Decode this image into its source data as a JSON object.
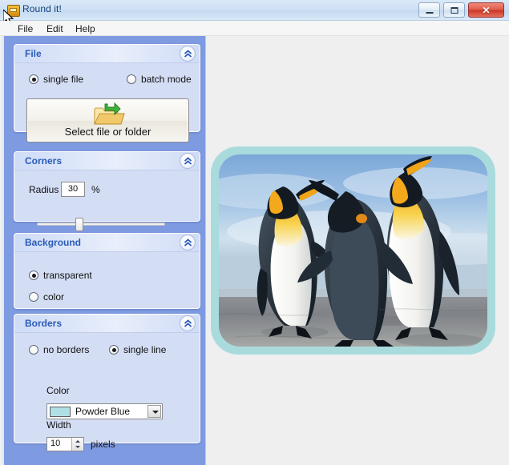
{
  "window": {
    "title": "Round it!",
    "icon": "app-icon",
    "buttons": {
      "minimize": "–",
      "maximize": "□",
      "close": "✕"
    }
  },
  "menubar": {
    "items": [
      {
        "label": "File"
      },
      {
        "label": "Edit"
      },
      {
        "label": "Help"
      }
    ]
  },
  "panels": {
    "file": {
      "title": "File",
      "collapse_icon": "double-chevron-up-icon",
      "radios": [
        {
          "label": "single file",
          "selected": true
        },
        {
          "label": "batch mode",
          "selected": false
        }
      ],
      "select_button": {
        "label": "Select file or folder",
        "icon": "open-folder-with-arrow-icon"
      }
    },
    "corners": {
      "title": "Corners",
      "collapse_icon": "double-chevron-up-icon",
      "radius_label": "Radius",
      "radius_value": "30",
      "unit": "%",
      "slider": {
        "value": 30,
        "min": 0,
        "max": 100
      }
    },
    "background": {
      "title": "Background",
      "collapse_icon": "double-chevron-up-icon",
      "radios": [
        {
          "label": "transparent",
          "selected": true
        },
        {
          "label": "color",
          "selected": false
        }
      ]
    },
    "borders": {
      "title": "Borders",
      "collapse_icon": "double-chevron-up-icon",
      "radios": [
        {
          "label": "no borders",
          "selected": false
        },
        {
          "label": "single line",
          "selected": true
        }
      ],
      "color_label": "Color",
      "color_value": "Powder Blue",
      "color_hex": "#B0E0E6",
      "width_label": "Width",
      "width_value": "10",
      "width_unit": "pixels"
    }
  },
  "preview": {
    "name": "penguins-photo",
    "border_color": "#a9dbdd",
    "corner_radius_px": 34,
    "border_width_px": 10,
    "alt": "Three king penguins on a beach"
  },
  "colors": {
    "sidebar_blue": "#7e9ae0",
    "panel_body": "#d3ddf4",
    "panel_title_text": "#2a5bb8",
    "content_bg": "#efefef",
    "titlebar_text": "#12407a",
    "close_red": "#c83523"
  }
}
